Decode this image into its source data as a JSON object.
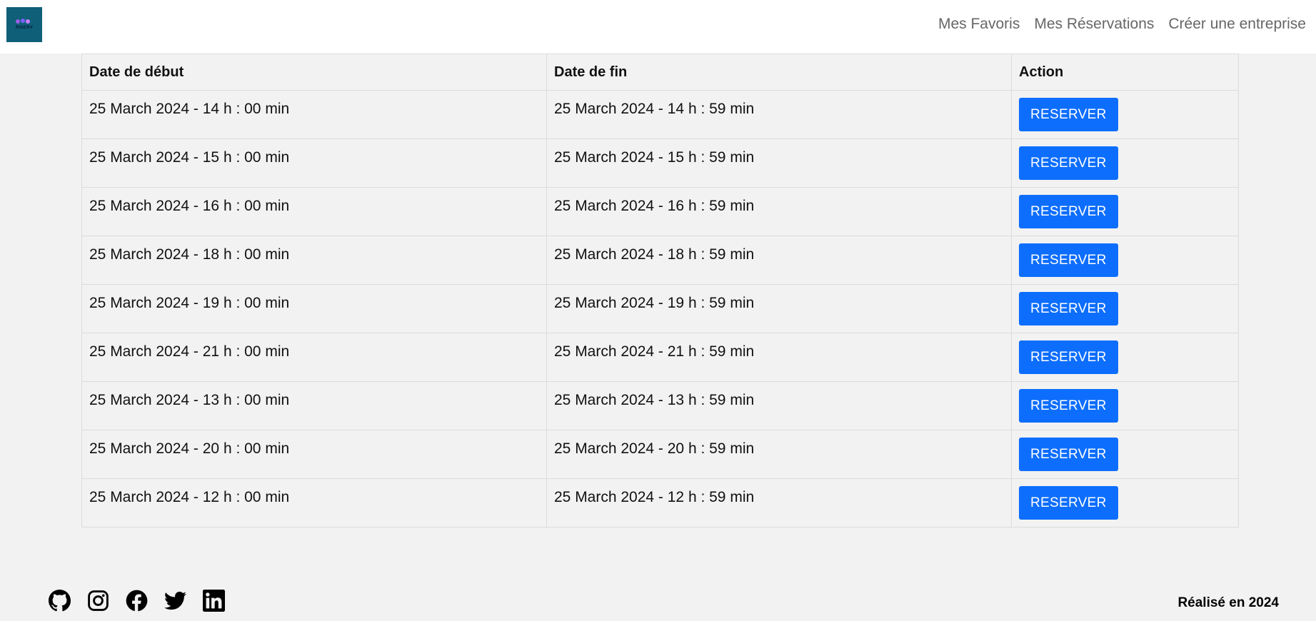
{
  "nav": {
    "logo_text": "RISERV",
    "links": [
      "Mes Favoris",
      "Mes Réservations",
      "Créer une entreprise"
    ]
  },
  "table": {
    "headers": {
      "start": "Date de début",
      "end": "Date de fin",
      "action": "Action"
    },
    "rows": [
      {
        "start": "25 March 2024 - 14 h : 00 min",
        "end": "25 March 2024 - 14 h : 59 min",
        "action_label": "RESERVER"
      },
      {
        "start": "25 March 2024 - 15 h : 00 min",
        "end": "25 March 2024 - 15 h : 59 min",
        "action_label": "RESERVER"
      },
      {
        "start": "25 March 2024 - 16 h : 00 min",
        "end": "25 March 2024 - 16 h : 59 min",
        "action_label": "RESERVER"
      },
      {
        "start": "25 March 2024 - 18 h : 00 min",
        "end": "25 March 2024 - 18 h : 59 min",
        "action_label": "RESERVER"
      },
      {
        "start": "25 March 2024 - 19 h : 00 min",
        "end": "25 March 2024 - 19 h : 59 min",
        "action_label": "RESERVER"
      },
      {
        "start": "25 March 2024 - 21 h : 00 min",
        "end": "25 March 2024 - 21 h : 59 min",
        "action_label": "RESERVER"
      },
      {
        "start": "25 March 2024 - 13 h : 00 min",
        "end": "25 March 2024 - 13 h : 59 min",
        "action_label": "RESERVER"
      },
      {
        "start": "25 March 2024 - 20 h : 00 min",
        "end": "25 March 2024 - 20 h : 59 min",
        "action_label": "RESERVER"
      },
      {
        "start": "25 March 2024 - 12 h : 00 min",
        "end": "25 March 2024 - 12 h : 59 min",
        "action_label": "RESERVER"
      }
    ]
  },
  "footer": {
    "social_icons": [
      "github-icon",
      "instagram-icon",
      "facebook-icon",
      "twitter-icon",
      "linkedin-icon"
    ],
    "credit": "Réalisé en 2024"
  },
  "colors": {
    "primary_button": "#0d6efd",
    "page_background": "#f2f2f2",
    "navbar_background": "#ffffff",
    "logo_background": "#0f5f78"
  }
}
